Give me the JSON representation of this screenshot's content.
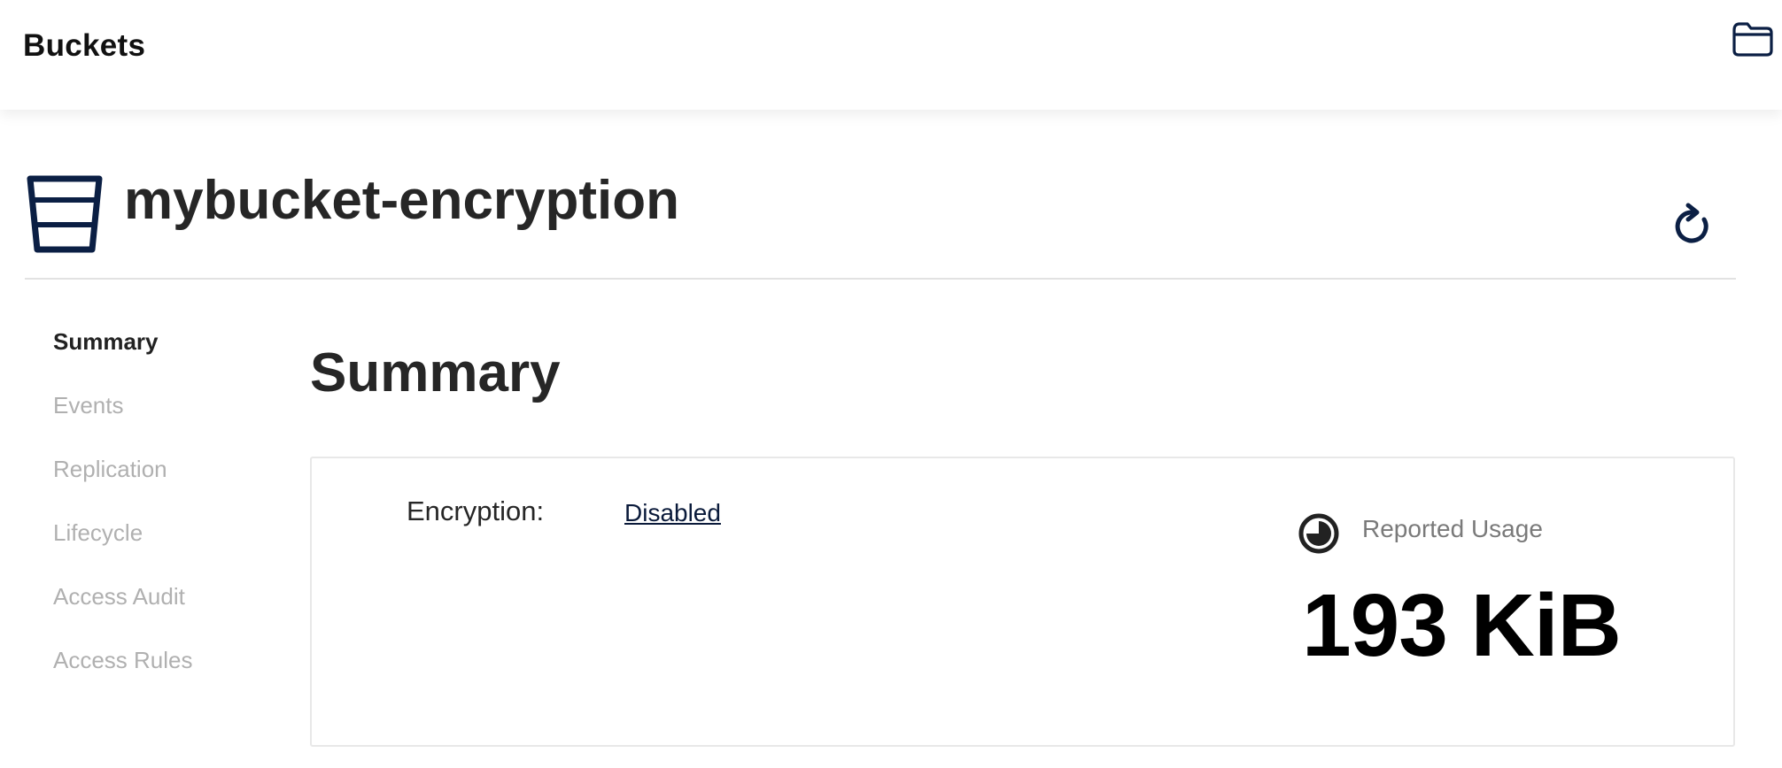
{
  "topbar": {
    "title": "Buckets",
    "folder_icon": "folder-icon"
  },
  "header": {
    "bucket_name": "mybucket-encryption",
    "bucket_icon": "bucket-icon",
    "refresh_icon": "refresh-icon"
  },
  "sidenav": {
    "items": [
      {
        "label": "Summary",
        "active": true
      },
      {
        "label": "Events",
        "active": false
      },
      {
        "label": "Replication",
        "active": false
      },
      {
        "label": "Lifecycle",
        "active": false
      },
      {
        "label": "Access Audit",
        "active": false
      },
      {
        "label": "Access Rules",
        "active": false
      }
    ]
  },
  "main": {
    "section_title": "Summary",
    "encryption": {
      "label": "Encryption:",
      "value": "Disabled"
    },
    "usage": {
      "icon": "pie-chart-icon",
      "label": "Reported Usage",
      "value": "193 KiB"
    }
  },
  "colors": {
    "navy_icon": "#0b1f44",
    "active_text": "#222222",
    "inactive_text": "#b0b0b0"
  }
}
